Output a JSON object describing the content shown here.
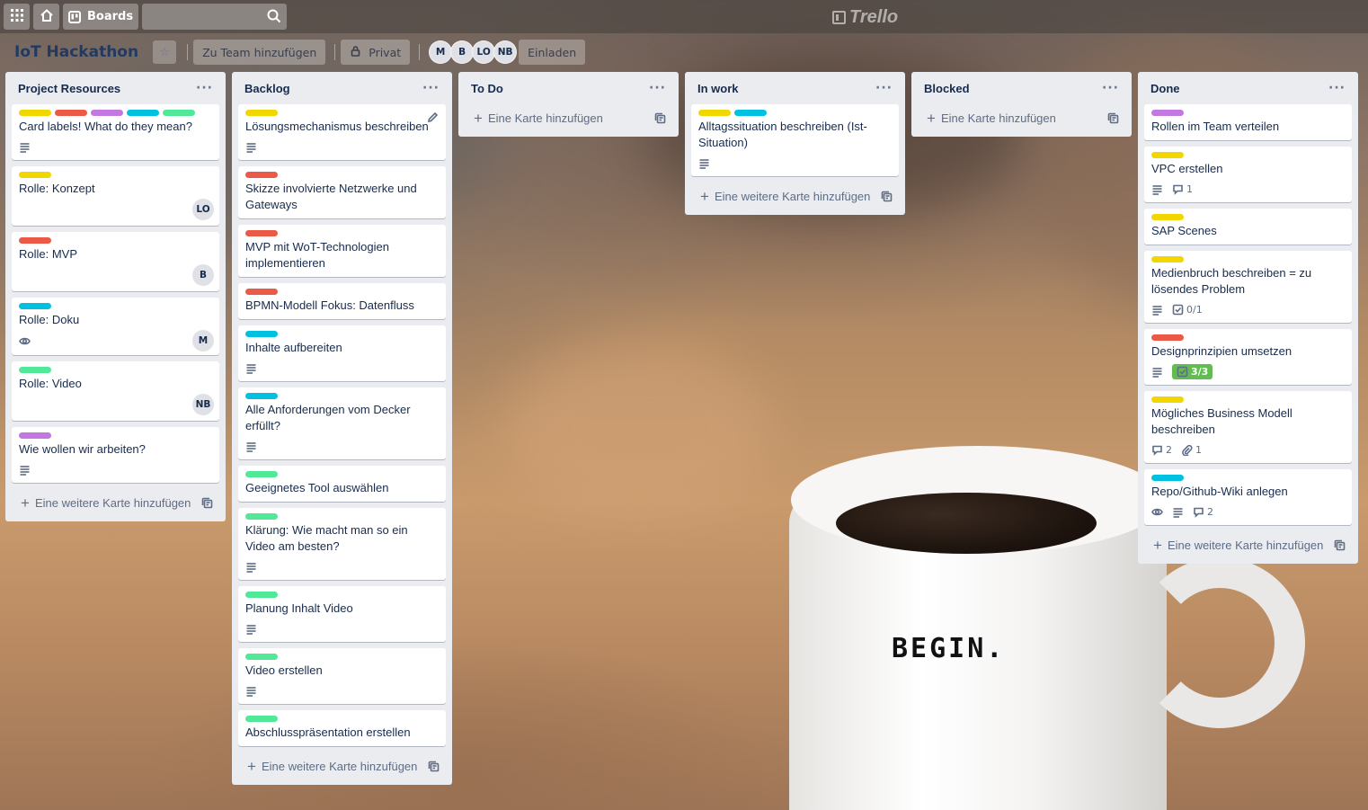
{
  "colors": {
    "yellow": "#f2d600",
    "red": "#eb5a46",
    "purple": "#c377e0",
    "sky": "#00c2e0",
    "lime": "#51e898",
    "green": "#61bd4f"
  },
  "topbar": {
    "apps_icon": "grid-icon",
    "home_icon": "home-icon",
    "boards_label": "Boards",
    "search_placeholder": "",
    "logo_text": "Trello"
  },
  "board": {
    "title": "IoT Hackathon",
    "team_button": "Zu Team hinzufügen",
    "visibility": "Privat",
    "members": [
      "M",
      "B",
      "LO",
      "NB"
    ],
    "invite_button": "Einladen"
  },
  "lists": [
    {
      "title": "Project Resources",
      "menu": "···",
      "add_label": "Eine weitere Karte hinzufügen",
      "cards": [
        {
          "title": "Card labels! What do they mean?",
          "labels": [
            "yellow",
            "red",
            "purple",
            "sky",
            "lime"
          ],
          "description": true
        },
        {
          "title": "Rolle: Konzept",
          "labels": [
            "yellow"
          ],
          "member": "LO"
        },
        {
          "title": "Rolle: MVP",
          "labels": [
            "red"
          ],
          "member": "B"
        },
        {
          "title": "Rolle: Doku",
          "labels": [
            "sky"
          ],
          "watch": true,
          "member": "M"
        },
        {
          "title": "Rolle: Video",
          "labels": [
            "lime"
          ],
          "member": "NB"
        },
        {
          "title": "Wie wollen wir arbeiten?",
          "labels": [
            "purple"
          ],
          "description": true
        }
      ]
    },
    {
      "title": "Backlog",
      "menu": "···",
      "add_label": "Eine weitere Karte hinzufügen",
      "cards": [
        {
          "title": "Lösungsmechanismus beschreiben",
          "labels": [
            "yellow"
          ],
          "description": true,
          "edit": true
        },
        {
          "title": "Skizze involvierte Netzwerke und Gateways",
          "labels": [
            "red"
          ]
        },
        {
          "title": "MVP mit WoT-Technologien implementieren",
          "labels": [
            "red"
          ]
        },
        {
          "title": "BPMN-Modell Fokus: Datenfluss",
          "labels": [
            "red"
          ]
        },
        {
          "title": "Inhalte aufbereiten",
          "labels": [
            "sky"
          ],
          "description": true
        },
        {
          "title": "Alle Anforderungen vom Decker erfüllt?",
          "labels": [
            "sky"
          ],
          "description": true
        },
        {
          "title": "Geeignetes Tool auswählen",
          "labels": [
            "lime"
          ]
        },
        {
          "title": "Klärung: Wie macht man so ein Video am besten?",
          "labels": [
            "lime"
          ],
          "description": true
        },
        {
          "title": "Planung Inhalt Video",
          "labels": [
            "lime"
          ],
          "description": true
        },
        {
          "title": "Video erstellen",
          "labels": [
            "lime"
          ],
          "description": true
        },
        {
          "title": "Abschlusspräsentation erstellen",
          "labels": [
            "lime"
          ]
        }
      ]
    },
    {
      "title": "To Do",
      "menu": "···",
      "add_label": "Eine Karte hinzufügen",
      "cards": []
    },
    {
      "title": "In work",
      "menu": "···",
      "add_label": "Eine weitere Karte hinzufügen",
      "cards": [
        {
          "title": "Alltagssituation beschreiben (Ist-Situation)",
          "labels": [
            "yellow",
            "sky"
          ],
          "description": true
        }
      ]
    },
    {
      "title": "Blocked",
      "menu": "···",
      "add_label": "Eine Karte hinzufügen",
      "cards": []
    },
    {
      "title": "Done",
      "menu": "···",
      "add_label": "Eine weitere Karte hinzufügen",
      "cards": [
        {
          "title": "Rollen im Team verteilen",
          "labels": [
            "purple"
          ]
        },
        {
          "title": "VPC erstellen",
          "labels": [
            "yellow"
          ],
          "description": true,
          "comments": "1"
        },
        {
          "title": "SAP Scenes",
          "labels": [
            "yellow"
          ]
        },
        {
          "title": "Medienbruch beschreiben = zu lösendes Problem",
          "labels": [
            "yellow"
          ],
          "description": true,
          "checklist": "0/1"
        },
        {
          "title": "Designprinzipien umsetzen",
          "labels": [
            "red"
          ],
          "description": true,
          "checklist": "3/3",
          "checklist_done": true
        },
        {
          "title": "Mögliches Business Modell beschreiben",
          "labels": [
            "yellow"
          ],
          "comments": "2",
          "attachments": "1"
        },
        {
          "title": "Repo/Github-Wiki anlegen",
          "labels": [
            "sky"
          ],
          "watch": true,
          "description": true,
          "comments": "2"
        }
      ]
    }
  ],
  "background": {
    "mug_text": "BEGIN."
  }
}
